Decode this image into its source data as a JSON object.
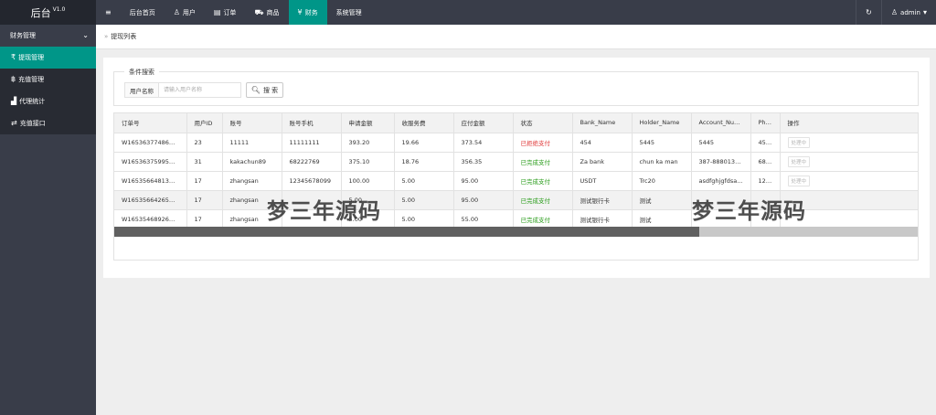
{
  "app": {
    "title": "后台",
    "version": "V1.0"
  },
  "nav": {
    "items": [
      {
        "label": "后台首页",
        "icon": ""
      },
      {
        "label": "用户",
        "icon": "user-icon"
      },
      {
        "label": "订单",
        "icon": "document-icon"
      },
      {
        "label": "商品",
        "icon": "cart-icon"
      },
      {
        "label": "财务",
        "icon": "yuan-icon",
        "active": true
      },
      {
        "label": "系统管理",
        "icon": ""
      }
    ],
    "user": "admin"
  },
  "sidebar": {
    "group": "财务管理",
    "items": [
      {
        "label": "提现管理",
        "icon": "rupee-icon",
        "active": true
      },
      {
        "label": "充值管理",
        "icon": "bitcoin-icon"
      },
      {
        "label": "代理统计",
        "icon": "chart-icon"
      },
      {
        "label": "充值接口",
        "icon": "exchange-icon"
      }
    ]
  },
  "breadcrumb": {
    "page": "提现列表"
  },
  "search": {
    "legend": "条件搜索",
    "label": "用户名称",
    "placeholder": "请输入用户名称",
    "value": "",
    "button": "搜 索"
  },
  "table": {
    "columns": [
      "订单号",
      "用户ID",
      "账号",
      "账号手机",
      "申请金额",
      "收服务费",
      "应付金额",
      "状态",
      "Bank_Name",
      "Holder_Name",
      "Account_Num...",
      "Phone_N",
      "操作"
    ],
    "rows": [
      {
        "order": "W165363774865741",
        "uid": "23",
        "account": "11111",
        "phone": "11111111",
        "amount": "393.20",
        "fee": "19.66",
        "payable": "373.54",
        "status": "已拒绝支付",
        "status_type": "red",
        "bank": "454",
        "holder": "5445",
        "acct": "5445",
        "phone_n": "4554",
        "op": "处理中"
      },
      {
        "order": "W165363759954359",
        "uid": "31",
        "account": "kakachun89",
        "phone": "68222769",
        "amount": "375.10",
        "fee": "18.76",
        "payable": "356.35",
        "status": "已完成支付",
        "status_type": "green",
        "bank": "Za bank",
        "holder": "chun ka man",
        "acct": "387-8880132...",
        "phone_n": "6822276",
        "op": "处理中"
      },
      {
        "order": "W165356648134531",
        "uid": "17",
        "account": "zhangsan",
        "phone": "12345678099",
        "amount": "100.00",
        "fee": "5.00",
        "payable": "95.00",
        "status": "已完成支付",
        "status_type": "green",
        "bank": "USDT",
        "holder": "Trc20",
        "acct": "asdfghjgfdsa...",
        "phone_n": "1234567",
        "op": "处理中"
      },
      {
        "order": "W165356642655610",
        "uid": "17",
        "account": "zhangsan",
        "phone": "",
        "amount": "5.00",
        "fee": "5.00",
        "payable": "95.00",
        "status": "已完成支付",
        "status_type": "green",
        "bank": "测试银行卡",
        "holder": "测试",
        "acct": "",
        "phone_n": "",
        "op": ""
      },
      {
        "order": "W165354689264853",
        "uid": "17",
        "account": "zhangsan",
        "phone": "",
        "amount": "5.00",
        "fee": "5.00",
        "payable": "55.00",
        "status": "已完成支付",
        "status_type": "green",
        "bank": "测试银行卡",
        "holder": "测试",
        "acct": "",
        "phone_n": "",
        "op": ""
      }
    ]
  },
  "watermark": "梦三年源码"
}
